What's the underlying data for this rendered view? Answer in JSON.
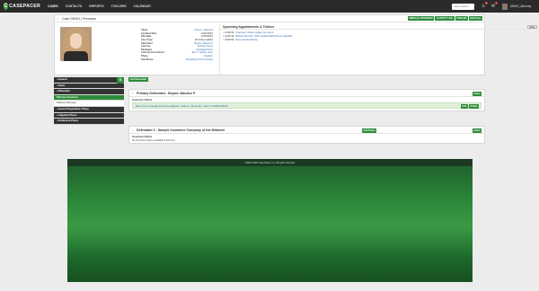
{
  "brand": {
    "name": "CASEPACER",
    "mark": "C"
  },
  "nav": [
    "CASES",
    "CONTACTS",
    "REPORTS",
    "TICKLERS",
    "CALENDAR"
  ],
  "search": {
    "placeholder": "Case Search"
  },
  "top_icons": {
    "notifications_count": "2",
    "messages_count": "1"
  },
  "user": {
    "name": "DEMO_Attorney"
  },
  "case": {
    "title": "Case DEMO | Premises",
    "actions": [
      "MEDICAL PROVIDER",
      "ACTIVITY LOG",
      "TICKLER",
      "Edit Case"
    ],
    "info": [
      {
        "label": "Client",
        "value": "Patty A. Claypuss",
        "link": true
      },
      {
        "label": "Accident Date",
        "value": "10/02/2019",
        "link": false
      },
      {
        "label": "SOL Date",
        "value": "10/02/2021",
        "link": false
      },
      {
        "label": "Case Type",
        "value": "Premises Liability",
        "link": false
      },
      {
        "label": "Defendant",
        "value": "Bryant, Maurice P",
        "link": true
      },
      {
        "label": "Attorney",
        "value": "Attorney Demo",
        "link": true
      },
      {
        "label": "Paralegal",
        "value": "Paralegal Demo",
        "link": true
      },
      {
        "label": "Attorney Fee Interest",
        "value": "Eric T. Jenkins, Esq.",
        "link": true
      },
      {
        "label": "Phase",
        "value": "Litigation",
        "link": true
      },
      {
        "label": "Sub-Phase",
        "value": "Scheduling Order Pending",
        "link": true
      }
    ]
  },
  "appointments": {
    "title": "Upcoming Appointments & Ticklers",
    "today_label": "Today",
    "items": [
      {
        "time": "12/30/19:",
        "text": "Treatment: Obtain update from client."
      },
      {
        "time": "12/27/19:",
        "text": "Medical Records: Order updated EDS (Demo Hospital)"
      },
      {
        "time": "01/02/20:",
        "text": "New Lawsuit Meeting"
      }
    ]
  },
  "sidebar": {
    "items": [
      {
        "label": "General",
        "style": "dark"
      },
      {
        "label": "Client",
        "style": "dark"
      },
      {
        "label": "Defendant",
        "style": "dark"
      },
      {
        "label": "Defense Insurance",
        "style": "active"
      },
      {
        "label": "Defense Attorneys",
        "style": "sub"
      },
      {
        "label": "General Negotiation Phase",
        "style": "dark"
      },
      {
        "label": "Litigation Phase",
        "style": "dark"
      },
      {
        "label": "Settlement Phase",
        "style": "dark"
      }
    ]
  },
  "defendants_panel": {
    "add_label": "Add Defendant",
    "cards": [
      {
        "title": "Primary Defendant - Bryant, Maurice P",
        "edit_label": "Claim",
        "claims_label": "Insurance Claims",
        "claim": "Ebury Fire & Casualty Insurance (Adjuster: Hoffman, Katrina M) - Claim #: 900891118444",
        "claim_buttons": [
          "Edit",
          "Delete"
        ]
      },
      {
        "title": "Defendant 2 - Sample Insurance Company of the Midwest",
        "inline_edit": "Edit Policy",
        "edit_label": "Claim",
        "claims_label": "Insurance Claims",
        "none_text": "No insurance claims available at this time."
      }
    ]
  },
  "footer": {
    "copyright": "©2007-2020 Case Pacer, Inc. All rights reserved."
  },
  "colors": {
    "accent": "#2e8b3a",
    "nav_bg": "#2a2a2a",
    "link": "#2f6db5"
  }
}
